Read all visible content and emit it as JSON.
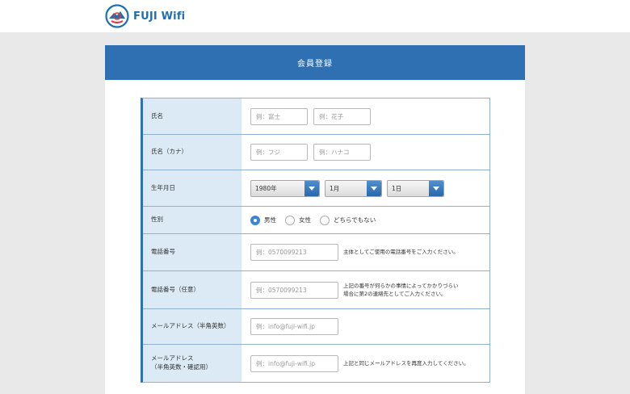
{
  "brand": {
    "name": "FUJI Wifi"
  },
  "page": {
    "title": "会員登録"
  },
  "form": {
    "name": {
      "label": "氏名",
      "last_placeholder": "例：富士",
      "first_placeholder": "例：花子"
    },
    "kana": {
      "label": "氏名（カナ）",
      "last_placeholder": "例：フジ",
      "first_placeholder": "例：ハナコ"
    },
    "birth": {
      "label": "生年月日",
      "year": "1980年",
      "month": "1月",
      "day": "1日"
    },
    "gender": {
      "label": "性別",
      "options": [
        "男性",
        "女性",
        "どちらでもない"
      ],
      "selected": "男性"
    },
    "phone": {
      "label": "電話番号",
      "placeholder": "例：0570099213",
      "note": "主体としてご使用の電話番号をご入力ください。"
    },
    "phone2": {
      "label": "電話番号（任意）",
      "placeholder": "例：0570099213",
      "note_line1": "上記の番号が何らかの事情によってかかりづらい",
      "note_line2": "場合に第2の連絡先としてご入力ください。"
    },
    "email": {
      "label": "メールアドレス（半角英数）",
      "placeholder": "例：info@fuji-wifi.jp"
    },
    "email_confirm": {
      "label_line1": "メールアドレス",
      "label_line2": "（半角英数・確認用）",
      "placeholder": "例：info@fuji-wifi.jp",
      "note": "上記と同じメールアドレスを再度入力してください。"
    }
  },
  "colors": {
    "brand": "#2f70b2",
    "label_bg": "#dbeaf5",
    "border": "#8fb1d2",
    "radio_selected": "#3a86d6"
  }
}
